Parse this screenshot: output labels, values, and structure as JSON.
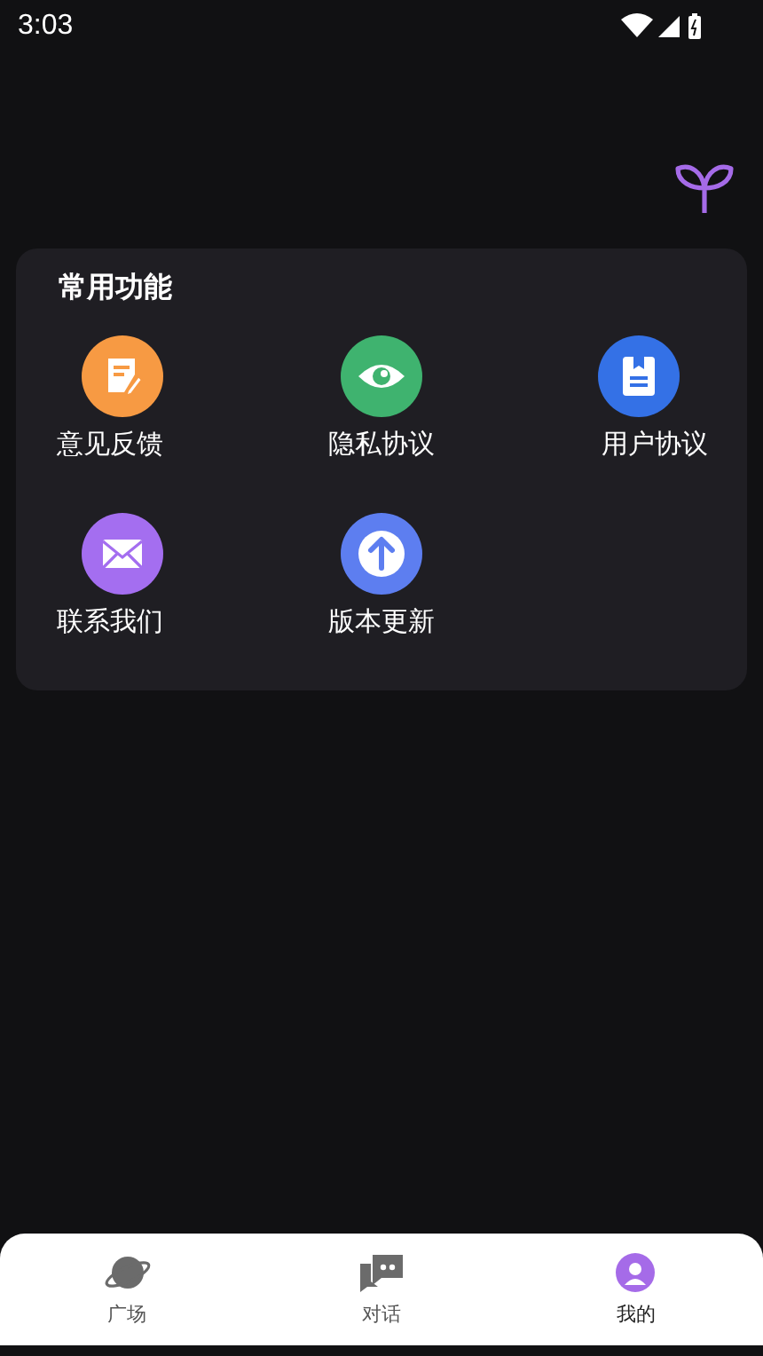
{
  "status_bar": {
    "time": "3:03"
  },
  "card": {
    "title": "常用功能",
    "items": [
      {
        "label": "意见反馈",
        "kind": "feedback",
        "color": "#f79a43"
      },
      {
        "label": "隐私协议",
        "kind": "privacy",
        "color": "#3fb36f"
      },
      {
        "label": "用户协议",
        "kind": "agreement",
        "color": "#3471e6"
      },
      {
        "label": "联系我们",
        "kind": "contact",
        "color": "#a46ef0"
      },
      {
        "label": "版本更新",
        "kind": "update",
        "color": "#5d7ef0"
      }
    ]
  },
  "tabs": [
    {
      "label": "广场",
      "kind": "square",
      "selected": false
    },
    {
      "label": "对话",
      "kind": "chat",
      "selected": false
    },
    {
      "label": "我的",
      "kind": "profile",
      "selected": true
    }
  ]
}
